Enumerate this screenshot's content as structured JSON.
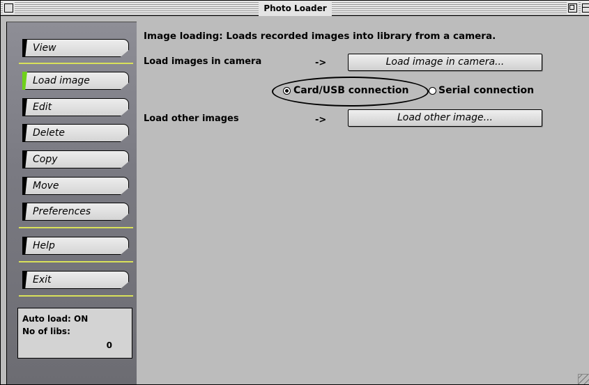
{
  "window": {
    "title": "Photo Loader"
  },
  "sidebar": {
    "items": [
      {
        "label": "View"
      },
      {
        "label": "Load image",
        "active": true
      },
      {
        "label": "Edit"
      },
      {
        "label": "Delete"
      },
      {
        "label": "Copy"
      },
      {
        "label": "Move"
      },
      {
        "label": "Preferences"
      },
      {
        "label": "Help"
      },
      {
        "label": "Exit"
      }
    ],
    "status": {
      "auto_load": "Auto load:  ON",
      "libs_label": "No of libs:",
      "libs_value": "0"
    }
  },
  "main": {
    "description": "Image loading: Loads recorded images into library from a camera.",
    "camera_row": {
      "label": "Load images in camera",
      "arrow": "->",
      "button": "Load image in camera..."
    },
    "connection": {
      "options": [
        {
          "label": "Card/USB connection",
          "selected": true
        },
        {
          "label": "Serial connection",
          "selected": false
        }
      ]
    },
    "other_row": {
      "label": "Load other images",
      "arrow": "->",
      "button": "Load other image..."
    }
  },
  "colors": {
    "active_tab": "#6fd11a",
    "separator": "#d9e15a",
    "background": "#bcbcbc"
  }
}
